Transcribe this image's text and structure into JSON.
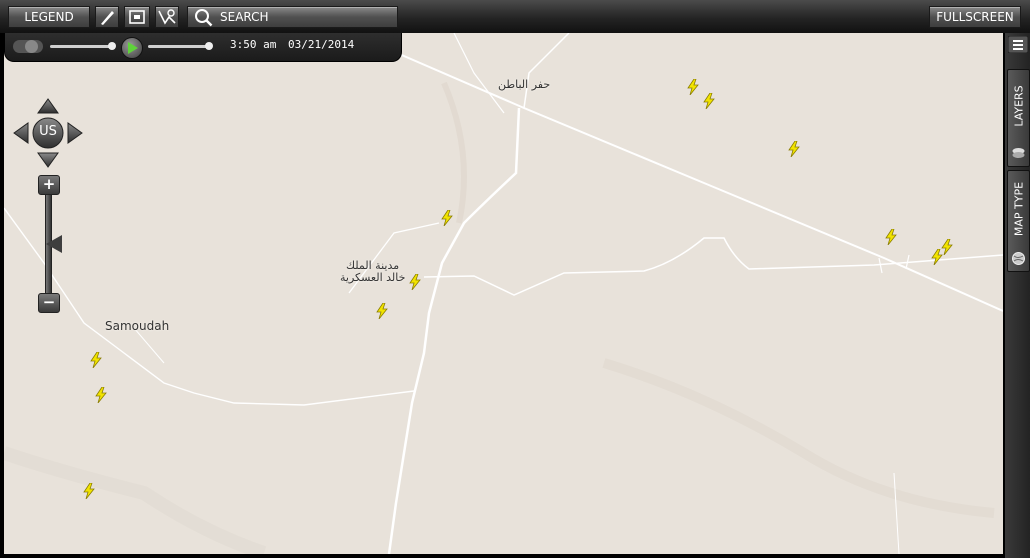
{
  "toolbar": {
    "legend_label": "LEGEND",
    "search_label": "SEARCH",
    "fullscreen_label": "FULLSCREEN"
  },
  "timeline": {
    "time": "3:50 am",
    "date": "03/21/2014"
  },
  "map": {
    "labels": {
      "hafr_albatin": "حفر الباطن",
      "kkmc_line1": "مدينة الملك",
      "kkmc_line2": "خالد العسكرية",
      "samoudah": "Samoudah"
    },
    "pan_label": "US",
    "zoom_in": "+",
    "zoom_out": "−"
  },
  "right_panel": {
    "layers_label": "LAYERS",
    "map_type_label": "MAP TYPE"
  },
  "colors": {
    "map_background": "#e8e2da",
    "road": "#ffffff",
    "lightning": "#f2e400",
    "toolbar": "#2e2e2e"
  },
  "icons": [
    "pencil-icon",
    "print-icon",
    "map-measure-icon",
    "search-icon",
    "menu-icon",
    "layers-icon",
    "globe-icon",
    "lightning-icon"
  ]
}
